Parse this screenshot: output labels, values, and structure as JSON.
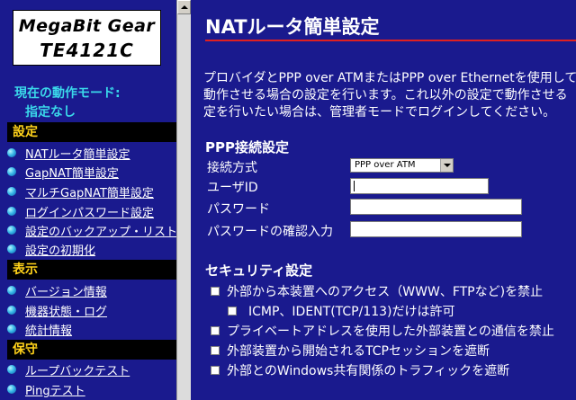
{
  "logo": {
    "line1": "MegaBit Gear",
    "line2": "TE4121C"
  },
  "mode": {
    "label": "現在の動作モード:",
    "value": "指定なし"
  },
  "nav": {
    "sections": [
      {
        "title": "設定",
        "items": [
          "NATルータ簡単設定",
          "GapNAT簡単設定",
          "マルチGapNAT簡単設定",
          "ログインパスワード設定",
          "設定のバックアップ・リストア",
          "設定の初期化"
        ]
      },
      {
        "title": "表示",
        "items": [
          "バージョン情報",
          "機器状態・ログ",
          "統計情報"
        ]
      },
      {
        "title": "保守",
        "items": [
          "ループバックテスト",
          "Pingテスト"
        ]
      }
    ]
  },
  "main": {
    "title": "NATルータ簡単設定",
    "intro": [
      "プロバイダとPPP over ATMまたはPPP over Ethernetを使用して",
      "動作させる場合の設定を行います。これ以外の設定で動作させる",
      "定を行いたい場合は、管理者モードでログインしてください。"
    ],
    "ppp": {
      "heading": "PPP接続設定",
      "method_label": "接続方式",
      "method_value": "PPP over ATM",
      "userid_label": "ユーザID",
      "userid_value": "",
      "password_label": "パスワード",
      "password_confirm_label": "パスワードの確認入力"
    },
    "security": {
      "heading": "セキュリティ設定",
      "options": [
        {
          "label": "外部から本装置へのアクセス（WWW、FTPなど)を禁止",
          "checked": false
        },
        {
          "label": "ICMP、IDENT(TCP/113)だけは許可",
          "checked": false
        },
        {
          "label": "プライベートアドレスを使用した外部装置との通信を禁止",
          "checked": false
        },
        {
          "label": "外部装置から開始されるTCPセッションを遮断",
          "checked": false
        },
        {
          "label": "外部とのWindows共有関係のトラフィックを遮断",
          "checked": false
        }
      ]
    }
  }
}
